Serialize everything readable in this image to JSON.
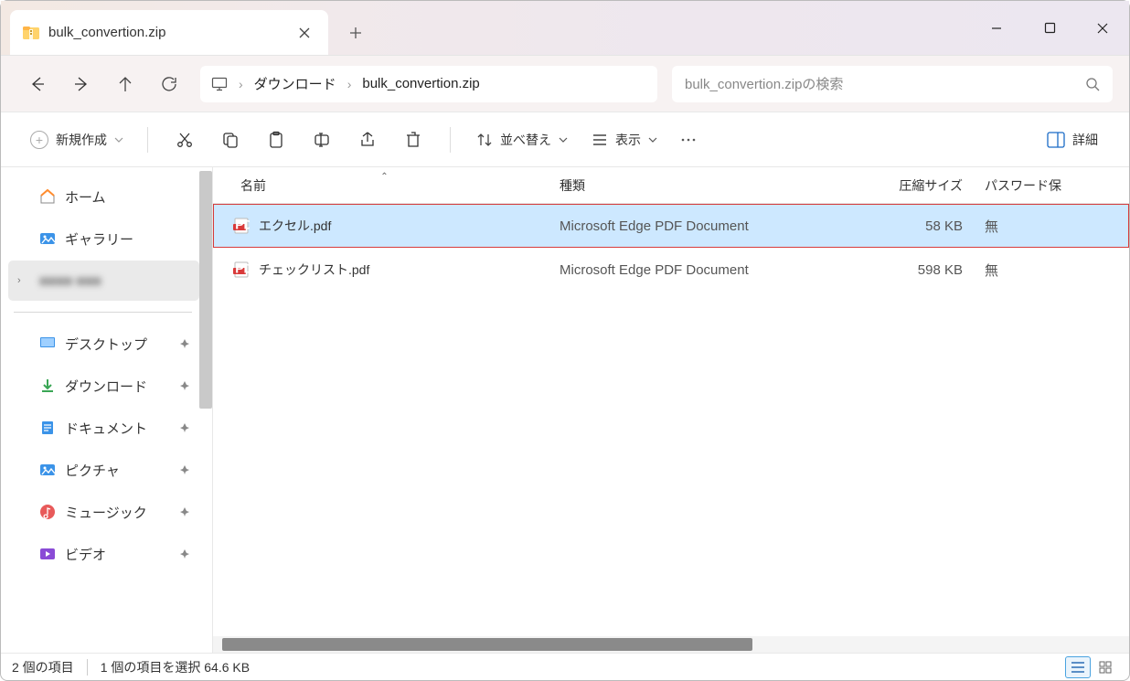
{
  "window": {
    "title": "bulk_convertion.zip"
  },
  "breadcrumbs": {
    "items": [
      "ダウンロード",
      "bulk_convertion.zip"
    ]
  },
  "search": {
    "placeholder": "bulk_convertion.zipの検索"
  },
  "toolbar": {
    "new_label": "新規作成",
    "sort_label": "並べ替え",
    "view_label": "表示",
    "details_label": "詳細"
  },
  "sidebar": {
    "home": "ホーム",
    "gallery": "ギャラリー",
    "hidden": "●●●●  ●●●",
    "desktop": "デスクトップ",
    "downloads": "ダウンロード",
    "documents": "ドキュメント",
    "pictures": "ピクチャ",
    "music": "ミュージック",
    "videos": "ビデオ"
  },
  "columns": {
    "name": "名前",
    "type": "種類",
    "size": "圧縮サイズ",
    "password": "パスワード保"
  },
  "files": [
    {
      "name": "エクセル.pdf",
      "type": "Microsoft Edge PDF Document",
      "size": "58 KB",
      "pw": "無",
      "selected": true
    },
    {
      "name": "チェックリスト.pdf",
      "type": "Microsoft Edge PDF Document",
      "size": "598 KB",
      "pw": "無",
      "selected": false
    }
  ],
  "status": {
    "count": "2 個の項目",
    "selection": "1 個の項目を選択 64.6 KB"
  }
}
